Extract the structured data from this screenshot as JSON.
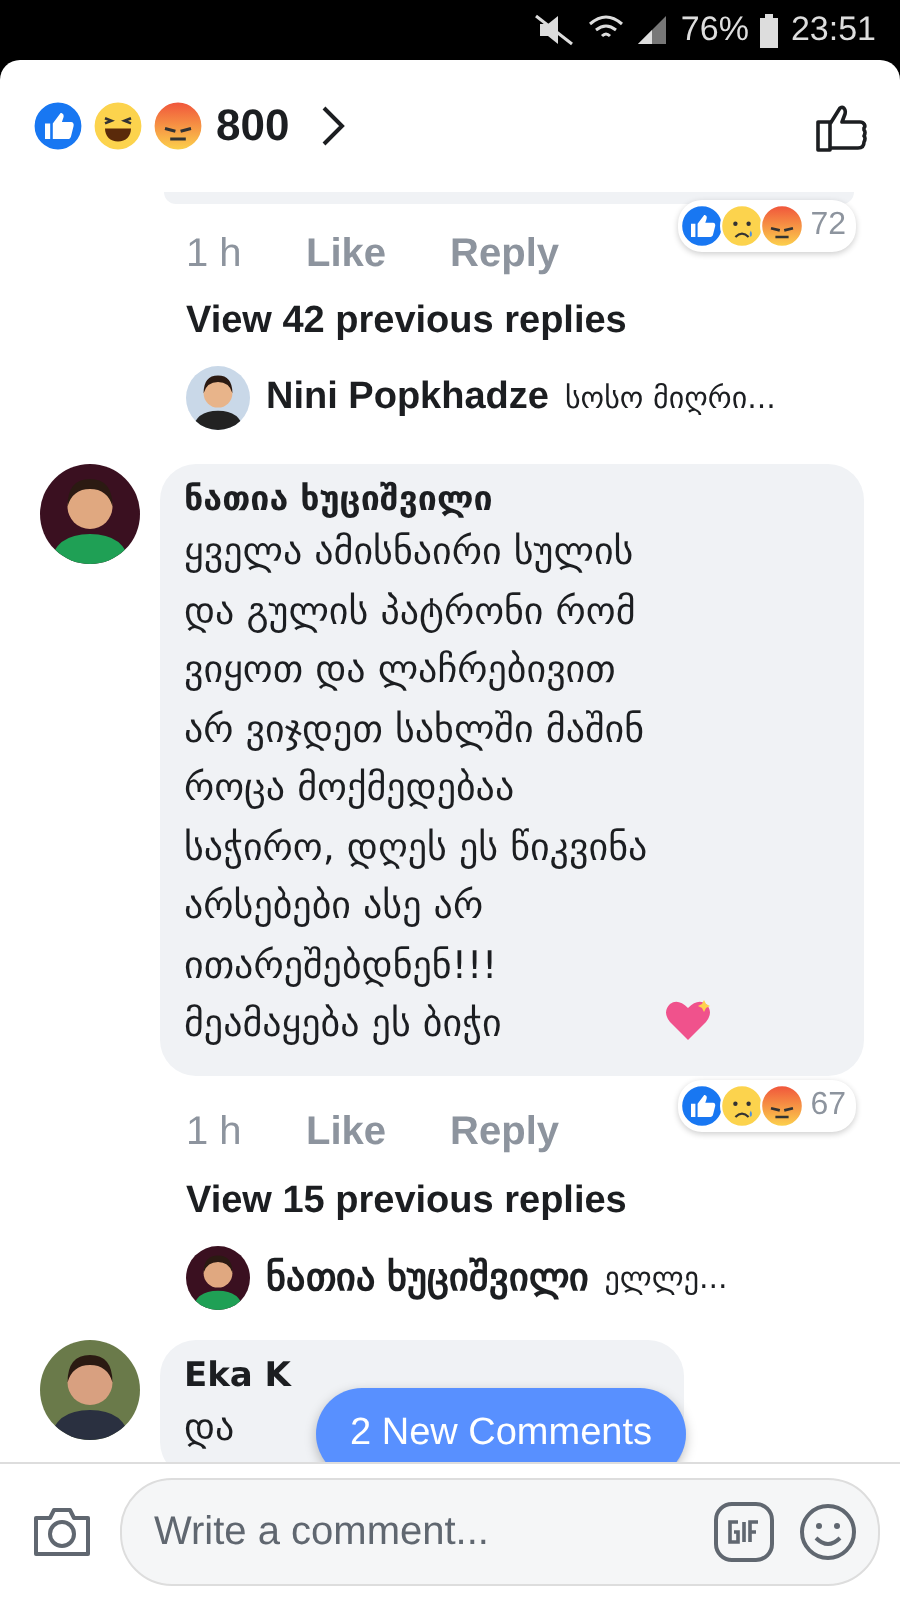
{
  "status_bar": {
    "battery": "76%",
    "time": "23:51"
  },
  "header": {
    "reactions": [
      {
        "kind": "like"
      },
      {
        "kind": "haha"
      },
      {
        "kind": "angry"
      }
    ],
    "count": "800"
  },
  "top_comment_meta": {
    "time": "1 h",
    "like": "Like",
    "reply": "Reply",
    "reactions": [
      {
        "kind": "like"
      },
      {
        "kind": "sad"
      },
      {
        "kind": "angry"
      }
    ],
    "count": "72"
  },
  "view_replies_1": "View 42 previous replies",
  "reply_preview_1": {
    "name": "Nini Popkhadze",
    "text": "სოსო მიღრი..."
  },
  "comment": {
    "name": "ნათია ხუციშვილი",
    "text": "ყველა ამისნაირი სულის\nდა გულის პატრონი რომ\nვიყოთ და ლაჩრებივით\nარ ვიჯდეთ სახლში მაშინ\nროცა მოქმედებაა\nსაჭირო, დღეს ეს წიკვინა\nარსებები ასე არ\nითარეშებდნენ!!!\nმეამაყება ეს ბიჭი",
    "time": "1 h",
    "like": "Like",
    "reply": "Reply",
    "reactions": [
      {
        "kind": "like"
      },
      {
        "kind": "sad"
      },
      {
        "kind": "angry"
      }
    ],
    "count": "67"
  },
  "view_replies_2": "View 15 previous replies",
  "reply_preview_2": {
    "name": "ნათია ხუციშვილი",
    "text": "ელლე..."
  },
  "next_comment": {
    "name": "Eka K",
    "text": "და"
  },
  "new_comments_button": "2 New Comments",
  "composer": {
    "placeholder": "Write a comment..."
  }
}
